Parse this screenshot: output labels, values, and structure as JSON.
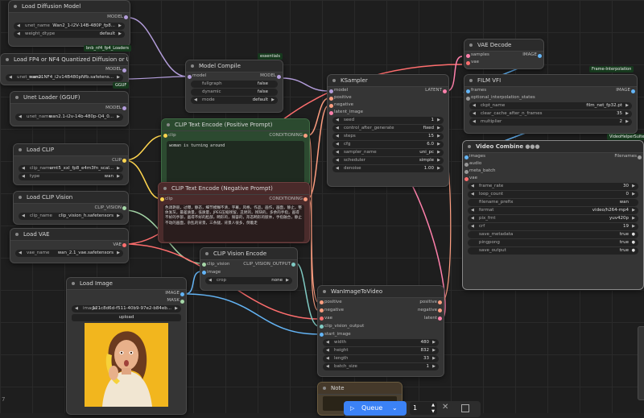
{
  "colors": {
    "model": "#b39ddb",
    "clip": "#ffd54f",
    "cond": "#ff9e80",
    "latent": "#ff80ab",
    "vae": "#ff6e6e",
    "image": "#64b5f6",
    "accent": "#3b82f6"
  },
  "tags": {
    "loaders": "bnb_nf4_fp4_Loaders",
    "essentials": "essentials",
    "gguf": "GGUF",
    "frame_interp": "Frame-Interpolation",
    "vhs": "VideoHelperSuite"
  },
  "nodes": {
    "load_diffusion": {
      "title": "Load Diffusion Model",
      "out": "MODEL",
      "unet_label": "unet_name",
      "unet_value": "Wan2_1-I2V-14B-480P_fp8...",
      "dtype_label": "weight_dtype",
      "dtype_value": "default"
    },
    "load_fp4": {
      "title": "Load FP4 or NF4 Quantized Diffusion or UNET",
      "out": "MODEL",
      "unet_label": "unet_name",
      "unet_value": "wan21NF4_i2v14B480pNfb.safetens..."
    },
    "model_compile": {
      "title": "Model Compile",
      "in": "model",
      "out": "MODEL",
      "w1_label": "fullgraph",
      "w1_value": "false",
      "w2_label": "dynamic",
      "w2_value": "false",
      "w3_label": "mode",
      "w3_value": "default"
    },
    "unet_gguf": {
      "title": "Unet Loader (GGUF)",
      "out": "MODEL",
      "unet_label": "unet_name",
      "unet_value": "wan2.1-i2v-14b-480p-Q4_0..."
    },
    "load_clip": {
      "title": "Load CLIP",
      "out": "CLIP",
      "w1_label": "clip_name",
      "w1_value": "umt5_xxl_fp8_e4m3fn_scal...",
      "w2_label": "type",
      "w2_value": "wan"
    },
    "load_clip_vision": {
      "title": "Load CLIP Vision",
      "out": "CLIP_VISION",
      "w_label": "clip_name",
      "w_value": "clip_vision_h.safetensors"
    },
    "load_vae": {
      "title": "Load VAE",
      "out": "VAE",
      "w_label": "vae_name",
      "w_value": "wan_2.1_vae.safetensors"
    },
    "clip_pos": {
      "title": "CLIP Text Encode (Positive Prompt)",
      "in": "clip",
      "out": "CONDITIONING",
      "text": "woman is turning around"
    },
    "clip_neg": {
      "title": "CLIP Text Encode (Negative Prompt)",
      "in": "clip",
      "out": "CONDITIONING",
      "text": "色调艳丽，过曝，静态，细节模糊不清，字幕，风格，作品，画作，画面，静止，整体发灰，最差质量，低质量，JPEG压缩残留，丑陋的，残缺的，多余的手指，画得不好的手部，画得不好的脸部，畸形的，毁容的，形态畸形的肢体，手指融合，静止不动的画面，杂乱的背景，三条腿，背景人很多，倒着走"
    },
    "clip_vision_encode": {
      "title": "CLIP Vision Encode",
      "in1": "clip_vision",
      "in2": "image",
      "out": "CLIP_VISION_OUTPUT",
      "w_label": "crop",
      "w_value": "none"
    },
    "load_image": {
      "title": "Load Image",
      "out1": "IMAGE",
      "out2": "MASK",
      "w_label": "image",
      "w_value": "121c8d6d-f511-40b9-97e2-b84eb...",
      "upload": "upload"
    },
    "ksampler": {
      "title": "KSampler",
      "in": [
        "model",
        "positive",
        "negative",
        "latent_image"
      ],
      "out": "LATENT",
      "widgets": [
        {
          "label": "seed",
          "value": "1"
        },
        {
          "label": "control_after_generate",
          "value": "fixed"
        },
        {
          "label": "steps",
          "value": "15"
        },
        {
          "label": "cfg",
          "value": "6.0"
        },
        {
          "label": "sampler_name",
          "value": "uni_pc"
        },
        {
          "label": "scheduler",
          "value": "simple"
        },
        {
          "label": "denoise",
          "value": "1.00"
        }
      ]
    },
    "vae_decode": {
      "title": "VAE Decode",
      "in1": "samples",
      "in2": "vae",
      "out": "IMAGE"
    },
    "film_vfi": {
      "title": "FILM VFI",
      "in1": "frames",
      "in2": "optional_interpolation_states",
      "out": "IMAGE",
      "widgets": [
        {
          "label": "ckpt_name",
          "value": "film_net_fp32.pt"
        },
        {
          "label": "clear_cache_after_n_frames",
          "value": "35"
        },
        {
          "label": "multiplier",
          "value": "2"
        }
      ]
    },
    "video_combine": {
      "title": "Video Combine",
      "title_icons": "●●●",
      "in": [
        "images",
        "audio",
        "meta_batch",
        "vae"
      ],
      "out": "Filenames",
      "widgets": [
        {
          "label": "frame_rate",
          "value": "30"
        },
        {
          "label": "loop_count",
          "value": "0"
        },
        {
          "label": "filename_prefix",
          "value": "wan"
        },
        {
          "label": "format",
          "value": "video/h264-mp4"
        },
        {
          "label": "pix_fmt",
          "value": "yuv420p"
        },
        {
          "label": "crf",
          "value": "19"
        },
        {
          "label": "save_metadata",
          "value": "true"
        },
        {
          "label": "pingpong",
          "value": "true"
        },
        {
          "label": "save_output",
          "value": "true"
        }
      ]
    },
    "wan_i2v": {
      "title": "WanImageToVideo",
      "in": [
        "positive",
        "negative",
        "vae",
        "clip_vision_output",
        "start_image"
      ],
      "out": [
        "positive",
        "negative",
        "latent"
      ],
      "widgets": [
        {
          "label": "width",
          "value": "480"
        },
        {
          "label": "height",
          "value": "832"
        },
        {
          "label": "length",
          "value": "33"
        },
        {
          "label": "batch_size",
          "value": "1"
        }
      ]
    },
    "note": {
      "title": "Note"
    }
  },
  "queue": {
    "label": "Queue",
    "count": "1"
  },
  "side_label": "7"
}
